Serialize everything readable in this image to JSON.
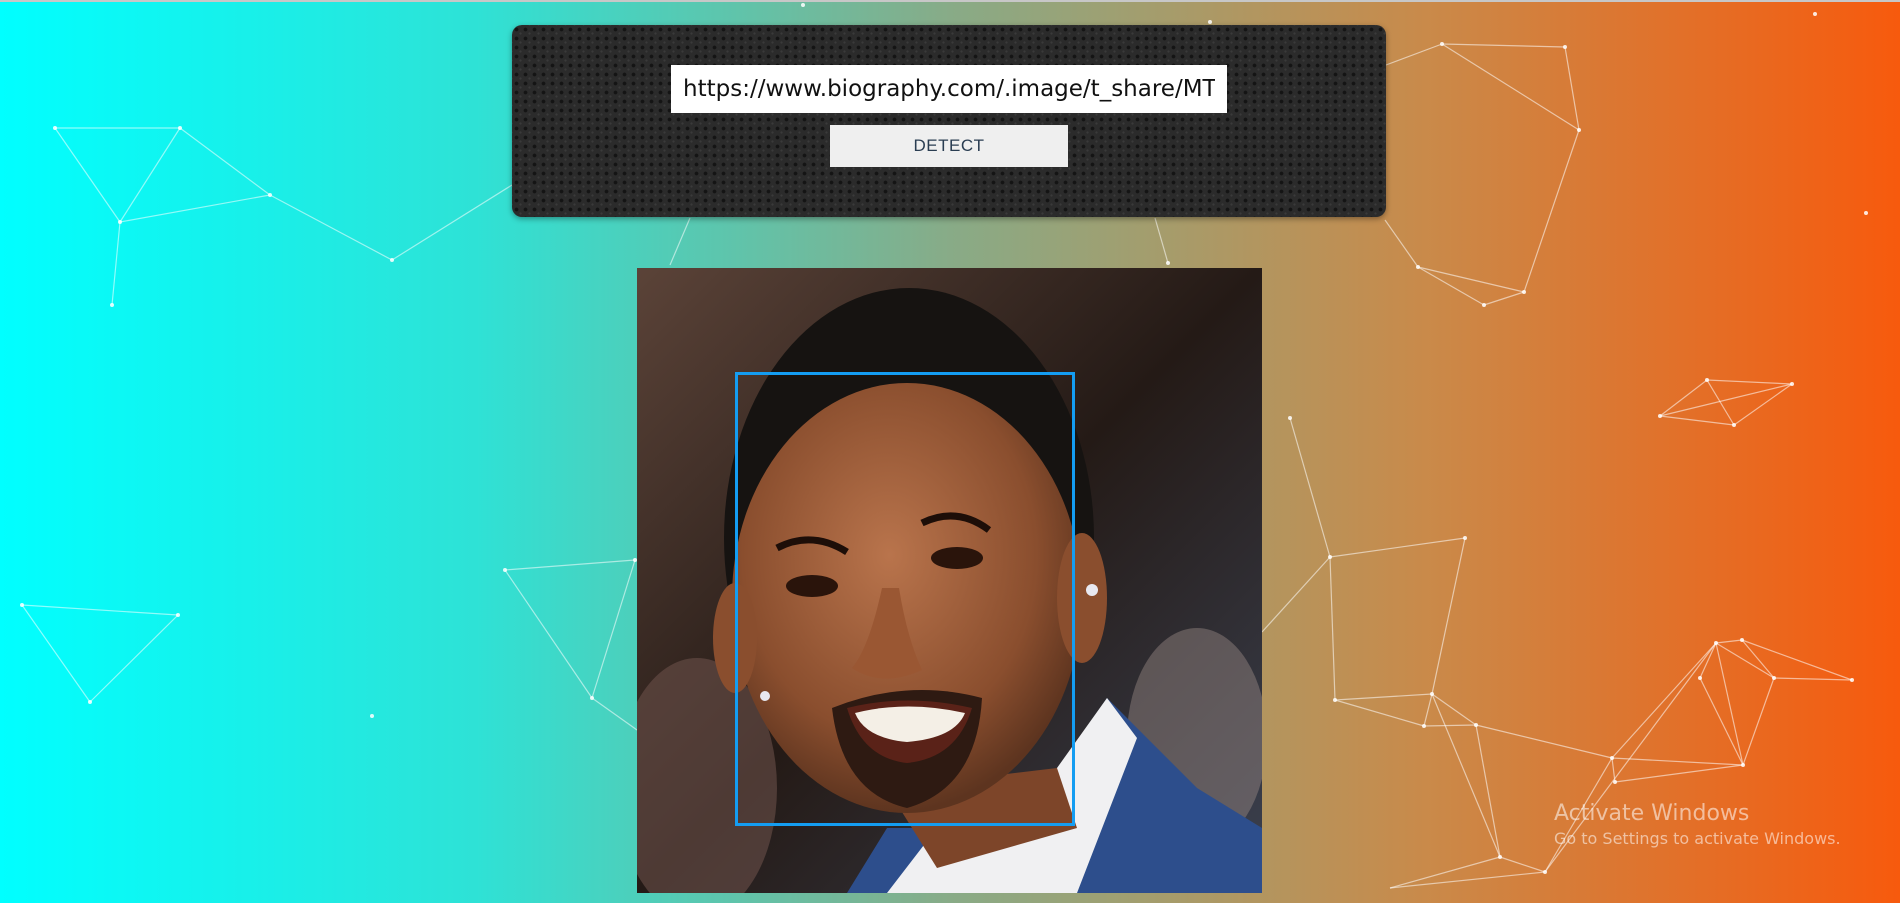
{
  "form": {
    "url_value": "https://www.biography.com/.image/t_share/MTE",
    "detect_label": "DETECT"
  },
  "result": {
    "image_description": "portrait photo of a smiling man",
    "face_box_color": "#149df2"
  },
  "watermark": {
    "title": "Activate Windows",
    "subtitle": "Go to Settings to activate Windows."
  },
  "colors": {
    "gradient_start": "#00ffff",
    "gradient_end": "#f75a0d",
    "panel": "#2b2b2b",
    "button_bg": "#efefef",
    "button_text": "#2a3d52"
  },
  "icons": [
    "particle-network-background"
  ]
}
